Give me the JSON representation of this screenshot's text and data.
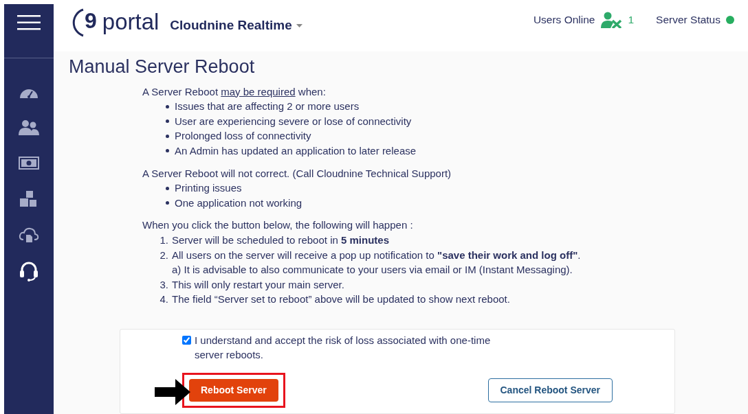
{
  "header": {
    "logo": {
      "mark": "9",
      "word": "portal"
    },
    "company": "Cloudnine Realtime",
    "users_online": {
      "label": "Users Online",
      "count": "1"
    },
    "server_status": {
      "label": "Server Status",
      "color": "#27ae60"
    }
  },
  "sidebar": {
    "items": [
      {
        "kind": "gauge",
        "selected": false
      },
      {
        "kind": "users",
        "selected": false
      },
      {
        "kind": "money",
        "selected": false
      },
      {
        "kind": "boxes",
        "selected": false
      },
      {
        "kind": "cloud",
        "selected": false
      },
      {
        "kind": "headset",
        "selected": true
      }
    ]
  },
  "page": {
    "title": "Manual Server Reboot",
    "required": {
      "before": "A Server Reboot",
      "link": "may be required",
      "after": "when:",
      "items": [
        "Issues that are affecting 2 or more users",
        "User are experiencing severe or lose of connectivity",
        "Prolonged loss of connectivity",
        "An Admin has updated an application to later release"
      ]
    },
    "not_correct": {
      "heading": "A Server Reboot will not correct. (Call Cloudnine Technical Support)",
      "items": [
        "Printing issues",
        "One application not working"
      ]
    },
    "steps": {
      "heading": "When you click the button below, the following will happen :",
      "items": [
        {
          "number": "1.",
          "text": "Server will be scheduled to reboot in **5 minutes**"
        },
        {
          "number": "2.",
          "text": "All users on the server will receive a pop up notification to **\"save their work and log off\"**.",
          "note": "a) It is advisable to also communicate to your users via email or IM (Instant Messaging)."
        },
        {
          "number": "3.",
          "text": "This will only restart your main server."
        },
        {
          "number": "4.",
          "text": "The field “Server set to reboot” above will be updated to show next reboot."
        }
      ]
    },
    "confirm": {
      "checked": true,
      "label": "I understand and accept the risk of loss associated with one-time server reboots."
    },
    "buttons": [
      {
        "kind": "primary",
        "label": "Reboot Server",
        "highlighted": true
      },
      {
        "kind": "outline",
        "label": "Cancel Reboot Server",
        "highlighted": false
      }
    ]
  }
}
